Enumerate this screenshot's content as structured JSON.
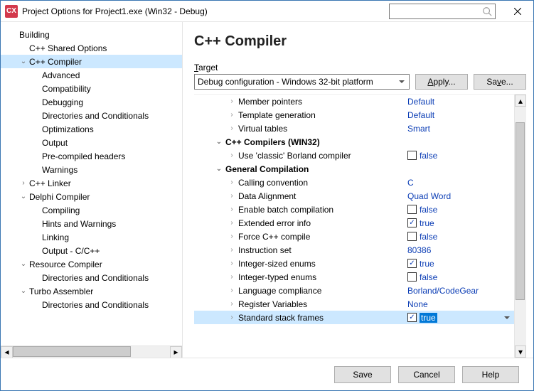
{
  "window": {
    "title": "Project Options for Project1.exe (Win32 - Debug)"
  },
  "sidebar": {
    "items": [
      {
        "label": "Building",
        "level": 0,
        "tw": ""
      },
      {
        "label": "C++ Shared Options",
        "level": 1,
        "tw": ""
      },
      {
        "label": "C++ Compiler",
        "level": 1,
        "tw": "v",
        "selected": true
      },
      {
        "label": "Advanced",
        "level": 2,
        "tw": ""
      },
      {
        "label": "Compatibility",
        "level": 2,
        "tw": ""
      },
      {
        "label": "Debugging",
        "level": 2,
        "tw": ""
      },
      {
        "label": "Directories and Conditionals",
        "level": 2,
        "tw": ""
      },
      {
        "label": "Optimizations",
        "level": 2,
        "tw": ""
      },
      {
        "label": "Output",
        "level": 2,
        "tw": ""
      },
      {
        "label": "Pre-compiled headers",
        "level": 2,
        "tw": ""
      },
      {
        "label": "Warnings",
        "level": 2,
        "tw": ""
      },
      {
        "label": "C++ Linker",
        "level": 1,
        "tw": ">"
      },
      {
        "label": "Delphi Compiler",
        "level": 1,
        "tw": "v"
      },
      {
        "label": "Compiling",
        "level": 2,
        "tw": ""
      },
      {
        "label": "Hints and Warnings",
        "level": 2,
        "tw": ""
      },
      {
        "label": "Linking",
        "level": 2,
        "tw": ""
      },
      {
        "label": "Output - C/C++",
        "level": 2,
        "tw": ""
      },
      {
        "label": "Resource Compiler",
        "level": 1,
        "tw": "v"
      },
      {
        "label": "Directories and Conditionals",
        "level": 2,
        "tw": ""
      },
      {
        "label": "Turbo Assembler",
        "level": 1,
        "tw": "v"
      },
      {
        "label": "Directories and Conditionals",
        "level": 2,
        "tw": ""
      }
    ]
  },
  "main": {
    "title": "C++ Compiler",
    "target_label": "Target",
    "target_value": "Debug configuration - Windows 32-bit platform",
    "apply_label": "Apply...",
    "save_label": "Save..."
  },
  "grid": {
    "rows": [
      {
        "indent": 2,
        "chev": ">",
        "label": "Member pointers",
        "value_text": "Default"
      },
      {
        "indent": 2,
        "chev": ">",
        "label": "Template generation",
        "value_text": "Default"
      },
      {
        "indent": 2,
        "chev": ">",
        "label": "Virtual tables",
        "value_text": "Smart"
      },
      {
        "indent": 1,
        "chev": "v",
        "label": "C++ Compilers (WIN32)",
        "bold": true
      },
      {
        "indent": 2,
        "chev": ">",
        "label": "Use 'classic' Borland compiler",
        "checkbox": false,
        "value_text": "false"
      },
      {
        "indent": 1,
        "chev": "v",
        "label": "General Compilation",
        "bold": true
      },
      {
        "indent": 2,
        "chev": ">",
        "label": "Calling convention",
        "value_text": "C"
      },
      {
        "indent": 2,
        "chev": ">",
        "label": "Data Alignment",
        "value_text": "Quad Word"
      },
      {
        "indent": 2,
        "chev": ">",
        "label": "Enable batch compilation",
        "checkbox": false,
        "value_text": "false"
      },
      {
        "indent": 2,
        "chev": ">",
        "label": "Extended error info",
        "checkbox": true,
        "value_text": "true"
      },
      {
        "indent": 2,
        "chev": ">",
        "label": "Force C++ compile",
        "checkbox": false,
        "value_text": "false"
      },
      {
        "indent": 2,
        "chev": ">",
        "label": "Instruction set",
        "value_text": "80386"
      },
      {
        "indent": 2,
        "chev": ">",
        "label": "Integer-sized enums",
        "checkbox": true,
        "value_text": "true"
      },
      {
        "indent": 2,
        "chev": ">",
        "label": "Integer-typed enums",
        "checkbox": false,
        "value_text": "false"
      },
      {
        "indent": 2,
        "chev": ">",
        "label": "Language compliance",
        "value_text": "Borland/CodeGear"
      },
      {
        "indent": 2,
        "chev": ">",
        "label": "Register Variables",
        "value_text": "None"
      },
      {
        "indent": 2,
        "chev": ">",
        "label": "Standard stack frames",
        "checkbox": true,
        "value_text": "true",
        "selected": true,
        "editing": true,
        "dropdown": true
      }
    ]
  },
  "footer": {
    "save": "Save",
    "cancel": "Cancel",
    "help": "Help"
  }
}
